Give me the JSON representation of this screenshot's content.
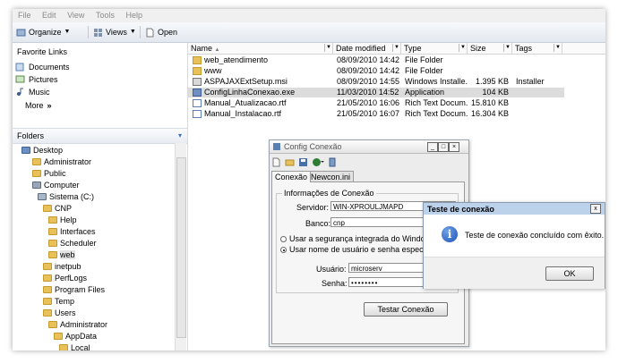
{
  "menu": [
    "File",
    "Edit",
    "View",
    "Tools",
    "Help"
  ],
  "toolbar": {
    "organize": "Organize",
    "views": "Views",
    "open": "Open"
  },
  "favorites": {
    "title": "Favorite Links",
    "items": [
      "Documents",
      "Pictures",
      "Music"
    ],
    "more": "More",
    "more_chevron": "»"
  },
  "folders": {
    "title": "Folders",
    "tree": [
      "Desktop",
      "Administrator",
      "Public",
      "Computer",
      "Sistema (C:)",
      "CNP",
      "Help",
      "Interfaces",
      "Scheduler",
      "web",
      "inetpub",
      "PerfLogs",
      "Program Files",
      "Temp",
      "Users",
      "Administrator",
      "AppData",
      "Local"
    ]
  },
  "columns": {
    "name": "Name",
    "date": "Date modified",
    "type": "Type",
    "size": "Size",
    "tags": "Tags"
  },
  "files": [
    {
      "name": "web_atendimento",
      "date": "08/09/2010 14:42",
      "type": "File Folder",
      "size": "",
      "tags": ""
    },
    {
      "name": "www",
      "date": "08/09/2010 14:42",
      "type": "File Folder",
      "size": "",
      "tags": ""
    },
    {
      "name": "ASPAJAXExtSetup.msi",
      "date": "08/09/2010 14:55",
      "type": "Windows Installe...",
      "size": "1.395 KB",
      "tags": "Installer"
    },
    {
      "name": "ConfigLinhaConexao.exe",
      "date": "11/03/2010 14:52",
      "type": "Application",
      "size": "104 KB",
      "tags": ""
    },
    {
      "name": "Manual_Atualizacao.rtf",
      "date": "21/05/2010 16:06",
      "type": "Rich Text Docum...",
      "size": "15.810 KB",
      "tags": ""
    },
    {
      "name": "Manual_Instalacao.rtf",
      "date": "21/05/2010 16:07",
      "type": "Rich Text Docum...",
      "size": "16.304 KB",
      "tags": ""
    }
  ],
  "config_dialog": {
    "title": "Config Conexão",
    "tabs": [
      "Conexão",
      "Newcon.ini"
    ],
    "group_title": "Informações de Conexão",
    "servidor_label": "Servidor:",
    "servidor_value": "WIN-XPROULJMAPD",
    "banco_label": "Banco:",
    "banco_value": "cnp",
    "radio_integrada": "Usar a segurança integrada do Windows N",
    "radio_usuario": "Usar nome de usuário e senha específico:",
    "usuario_label": "Usuário:",
    "usuario_value": "microserv",
    "senha_label": "Senha:",
    "senha_value": "••••••••",
    "test_button": "Testar Conexão"
  },
  "message_box": {
    "title": "Teste de conexão",
    "text": "Teste de conexão concluído com êxito.",
    "ok": "OK",
    "close": "x"
  },
  "colors": {
    "folder": "#e8c15a",
    "msg_title_bar": "#bcd1ea",
    "selected_row": "#dcdcdc",
    "info_icon": "#1f55b4"
  }
}
